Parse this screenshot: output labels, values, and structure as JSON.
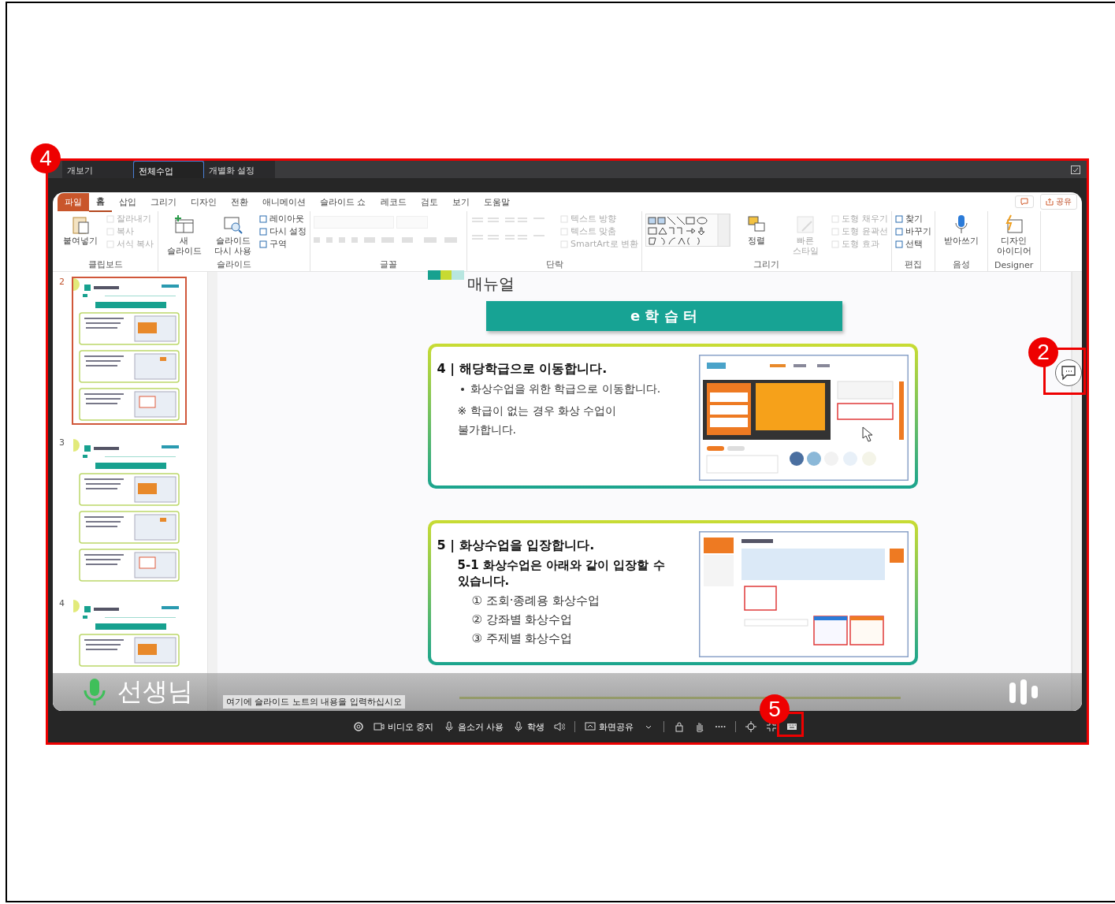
{
  "app": {
    "annotation": "4",
    "tabs": [
      {
        "label": "개보기",
        "selected": false
      },
      {
        "label": "전체수업",
        "selected": true
      },
      {
        "label": "개별화 설정",
        "selected": false
      }
    ],
    "ppt": {
      "ribbon_tabs": [
        {
          "label": "파일",
          "kind": "file",
          "selected": false
        },
        {
          "label": "홈",
          "kind": "tab",
          "selected": true
        },
        {
          "label": "삽입",
          "kind": "tab",
          "selected": false
        },
        {
          "label": "그리기",
          "kind": "tab",
          "selected": false
        },
        {
          "label": "디자인",
          "kind": "tab",
          "selected": false
        },
        {
          "label": "전환",
          "kind": "tab",
          "selected": false
        },
        {
          "label": "애니메이션",
          "kind": "tab",
          "selected": false
        },
        {
          "label": "슬라이드 쇼",
          "kind": "tab",
          "selected": false
        },
        {
          "label": "레코드",
          "kind": "tab",
          "selected": false
        },
        {
          "label": "검토",
          "kind": "tab",
          "selected": false
        },
        {
          "label": "보기",
          "kind": "tab",
          "selected": false
        },
        {
          "label": "도움말",
          "kind": "tab",
          "selected": false
        }
      ],
      "share_button": "공유",
      "groups": [
        {
          "label": "클립보드",
          "items": [
            {
              "kind": "large",
              "label": "붙여넣기",
              "disabled": false
            },
            {
              "kind": "small",
              "label": "잘라내기",
              "disabled": true
            },
            {
              "kind": "small",
              "label": "복사",
              "disabled": true
            },
            {
              "kind": "small",
              "label": "서식 복사",
              "disabled": true
            }
          ]
        },
        {
          "label": "슬라이드",
          "items": [
            {
              "kind": "large",
              "label": "새 슬라이드",
              "disabled": false
            },
            {
              "kind": "large",
              "label": "슬라이드 다시 사용",
              "disabled": false
            },
            {
              "kind": "small",
              "label": "레이아웃",
              "disabled": false
            },
            {
              "kind": "small",
              "label": "다시 설정",
              "disabled": false
            },
            {
              "kind": "small",
              "label": "구역",
              "disabled": false
            }
          ]
        },
        {
          "label": "글꼴",
          "items": [
            {
              "kind": "font-field",
              "disabled": true
            }
          ]
        },
        {
          "label": "단락",
          "items": [
            {
              "kind": "paragraph",
              "disabled": true
            },
            {
              "kind": "small",
              "label": "텍스트 방향",
              "disabled": true
            },
            {
              "kind": "small",
              "label": "텍스트 맞춤",
              "disabled": true
            },
            {
              "kind": "small",
              "label": "SmartArt로 변환",
              "disabled": true
            }
          ]
        },
        {
          "label": "그리기",
          "items": [
            {
              "kind": "shapes",
              "disabled": false
            },
            {
              "kind": "large",
              "label": "정렬",
              "disabled": false
            },
            {
              "kind": "large",
              "label": "빠른 스타일",
              "disabled": true
            },
            {
              "kind": "small",
              "label": "도형 채우기",
              "disabled": true
            },
            {
              "kind": "small",
              "label": "도형 윤곽선",
              "disabled": true
            },
            {
              "kind": "small",
              "label": "도형 효과",
              "disabled": true
            }
          ]
        },
        {
          "label": "편집",
          "items": [
            {
              "kind": "small",
              "label": "찾기",
              "disabled": false
            },
            {
              "kind": "small",
              "label": "바꾸기",
              "disabled": false
            },
            {
              "kind": "small",
              "label": "선택",
              "disabled": false
            }
          ]
        },
        {
          "label": "음성",
          "items": [
            {
              "kind": "large",
              "label": "받아쓰기",
              "disabled": false
            }
          ]
        },
        {
          "label": "Designer",
          "items": [
            {
              "kind": "large",
              "label": "디자인 아이디어",
              "disabled": false
            }
          ]
        }
      ],
      "thumbnails": [
        {
          "number": "2",
          "selected": true
        },
        {
          "number": "3",
          "selected": false
        },
        {
          "number": "4",
          "selected": false
        }
      ],
      "slide": {
        "title": "매뉴얼",
        "banner": "e 학 습 터",
        "cards": [
          {
            "heading": "4 | 해당학급으로 이동합니다.",
            "lines": [
              {
                "kind": "bullet",
                "text": "화상수업을 위한 학급으로 이동합니다."
              },
              {
                "kind": "note",
                "text": "※ 학급이 없는 경우 화상 수업이 불가합니다."
              }
            ]
          },
          {
            "heading": "5 | 화상수업을 입장합니다.",
            "lines": [
              {
                "kind": "sub",
                "text": "5-1 화상수업은 아래와 같이 입장할 수 있습니다."
              },
              {
                "kind": "numbered",
                "text": "① 조회·종례용 화상수업"
              },
              {
                "kind": "numbered",
                "text": "② 강좌별 화상수업"
              },
              {
                "kind": "numbered",
                "text": "③ 주제별 화상수업"
              }
            ]
          }
        ]
      },
      "notes_placeholder": "여기에 슬라이드 노트의 내용을 입력하십시오",
      "speaker": {
        "name": "선생님",
        "muted": false
      }
    },
    "chat_button": {
      "annotation": "2"
    },
    "toolbar": [
      {
        "kind": "icon"
      },
      {
        "kind": "labeled",
        "label": "비디오 중지"
      },
      {
        "kind": "labeled",
        "label": "음소거 사용"
      },
      {
        "kind": "labeled",
        "label": "학생"
      },
      {
        "kind": "icon"
      },
      {
        "kind": "divider"
      },
      {
        "kind": "labeled",
        "label": "화면공유"
      },
      {
        "kind": "icon"
      },
      {
        "kind": "divider"
      },
      {
        "kind": "icon"
      },
      {
        "kind": "icon"
      },
      {
        "kind": "icon"
      },
      {
        "kind": "divider"
      },
      {
        "kind": "icon"
      },
      {
        "kind": "icon"
      },
      {
        "kind": "icon",
        "annotation": "5"
      }
    ]
  }
}
